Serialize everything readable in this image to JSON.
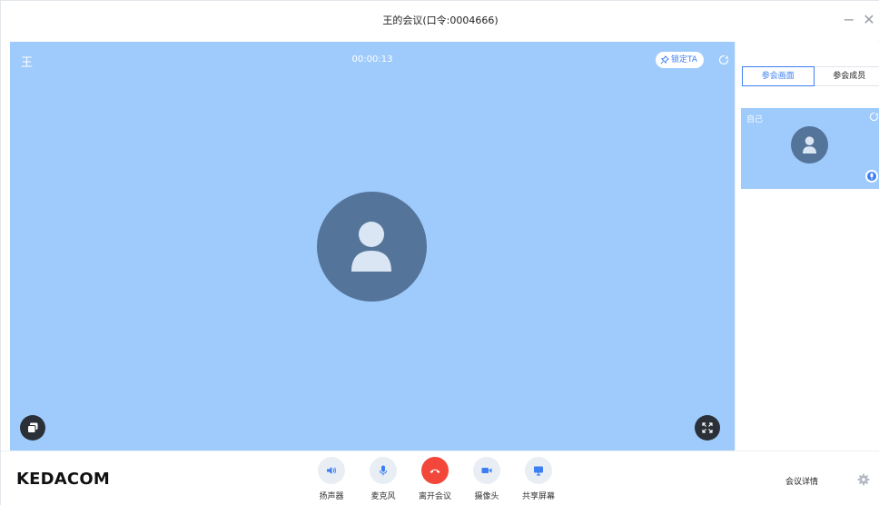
{
  "window": {
    "title": "王的会议(口令:0004666)",
    "minimize": "−",
    "close": "✕"
  },
  "main_video": {
    "participant_name": "王",
    "timer": "00:00:13",
    "lock_label": "锁定TA"
  },
  "side_panel": {
    "tabs": [
      {
        "label": "参会画面",
        "active": true
      },
      {
        "label": "参会成员",
        "active": false
      }
    ],
    "thumbnail": {
      "name": "自己"
    }
  },
  "bottom_bar": {
    "logo": "KEDACOM",
    "controls": [
      {
        "label": "扬声器",
        "icon": "speaker-icon"
      },
      {
        "label": "麦克风",
        "icon": "microphone-icon"
      },
      {
        "label": "离开会议",
        "icon": "hang-up-icon"
      },
      {
        "label": "摄像头",
        "icon": "camera-icon"
      },
      {
        "label": "共享屏幕",
        "icon": "share-screen-icon"
      }
    ],
    "details_label": "会议详情"
  },
  "colors": {
    "video_bg": "#9ecbfb",
    "avatar_bg": "#55749a",
    "accent": "#3d7ff2",
    "leave_red": "#f2473a",
    "control_bg": "#e9eef5"
  }
}
